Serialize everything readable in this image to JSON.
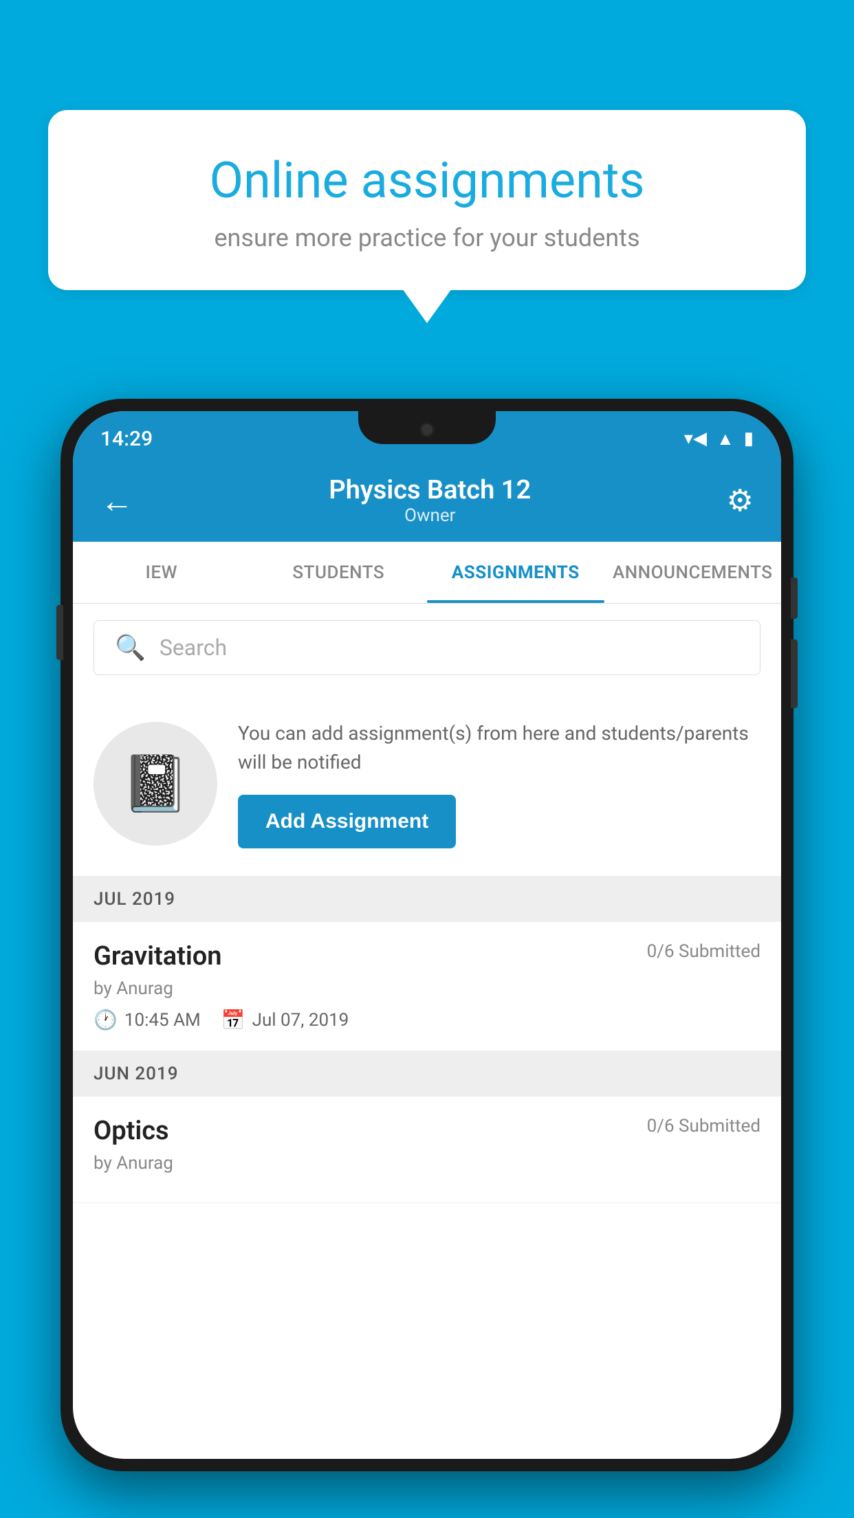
{
  "background_color": "#00AADD",
  "speech_bubble": {
    "title": "Online assignments",
    "subtitle": "ensure more practice for your students"
  },
  "phone": {
    "status_bar": {
      "time": "14:29",
      "icons": [
        "wifi",
        "signal",
        "battery"
      ]
    },
    "app_bar": {
      "title": "Physics Batch 12",
      "subtitle": "Owner",
      "back_label": "←",
      "settings_label": "⚙"
    },
    "tabs": [
      {
        "label": "IEW",
        "active": false
      },
      {
        "label": "STUDENTS",
        "active": false
      },
      {
        "label": "ASSIGNMENTS",
        "active": true
      },
      {
        "label": "ANNOUNCEMENTS",
        "active": false
      }
    ],
    "search": {
      "placeholder": "Search"
    },
    "promo": {
      "icon": "📓",
      "description": "You can add assignment(s) from here and students/parents will be notified",
      "button_label": "Add Assignment"
    },
    "sections": [
      {
        "header": "JUL 2019",
        "assignments": [
          {
            "title": "Gravitation",
            "submitted": "0/6 Submitted",
            "author": "by Anurag",
            "time": "10:45 AM",
            "date": "Jul 07, 2019"
          }
        ]
      },
      {
        "header": "JUN 2019",
        "assignments": [
          {
            "title": "Optics",
            "submitted": "0/6 Submitted",
            "author": "by Anurag",
            "time": "",
            "date": ""
          }
        ]
      }
    ]
  }
}
